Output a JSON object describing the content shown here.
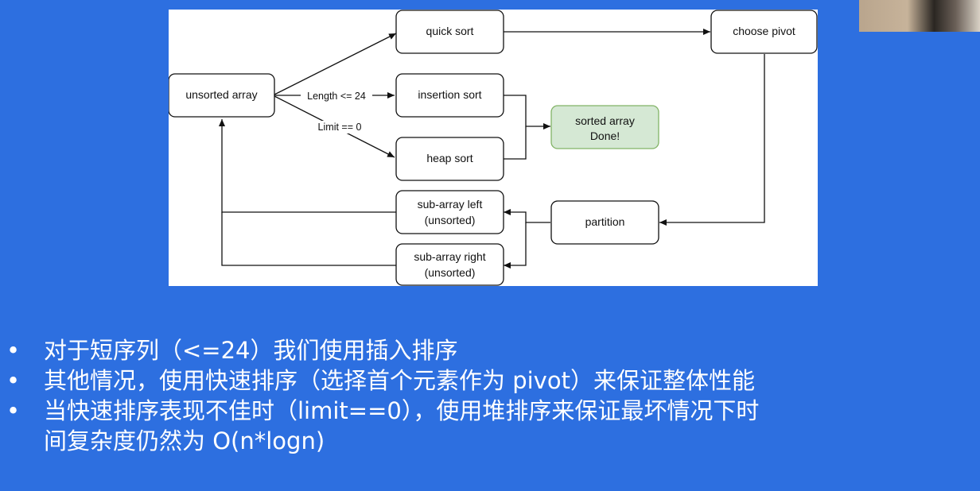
{
  "diagram": {
    "nodes": {
      "unsorted": [
        "unsorted array"
      ],
      "quick": [
        "quick sort"
      ],
      "pivot": [
        "choose pivot"
      ],
      "insertion": [
        "insertion sort"
      ],
      "heap": [
        "heap sort"
      ],
      "done": [
        "sorted array",
        "Done!"
      ],
      "partition": [
        "partition"
      ],
      "subleft": [
        "sub-array left",
        "(unsorted)"
      ],
      "subright": [
        "sub-array right",
        "(unsorted)"
      ]
    },
    "edge_labels": {
      "length": "Length <= 24",
      "limit": "Limit == 0"
    },
    "colors": {
      "done_fill": "#d5e8d4",
      "done_stroke": "#82b366",
      "background": "#2d6fe0"
    }
  },
  "bullets": [
    {
      "lines": [
        "对于短序列（<=24）我们使用插入排序"
      ]
    },
    {
      "lines": [
        "其他情况，使用快速排序（选择首个元素作为 pivot）来保证整体性能"
      ]
    },
    {
      "lines": [
        "当快速排序表现不佳时（limit==0），使用堆排序来保证最坏情况下时",
        "间复杂度仍然为 O(n*logn)"
      ]
    }
  ],
  "bullet_symbol": "•"
}
